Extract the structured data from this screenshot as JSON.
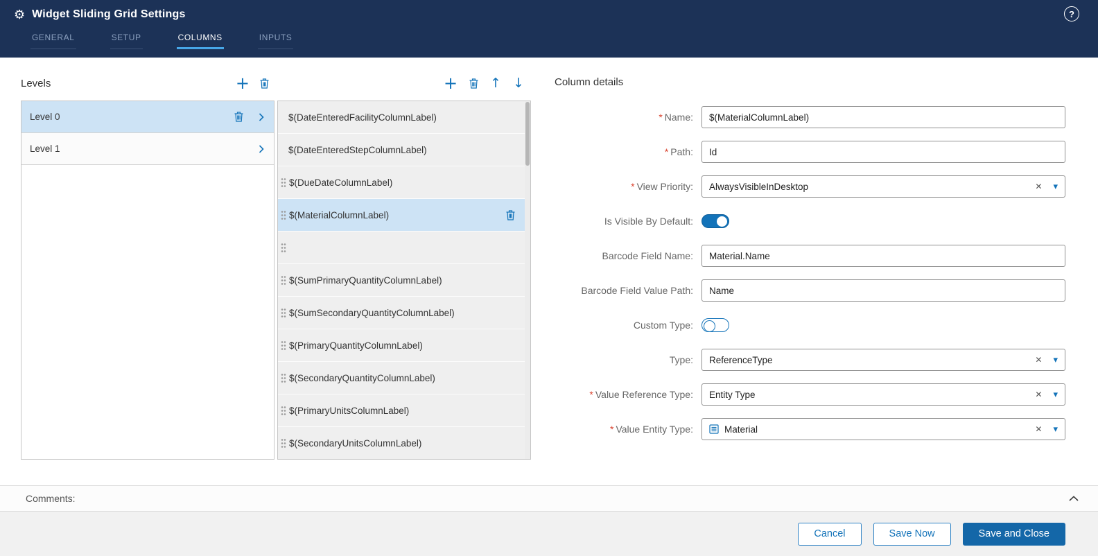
{
  "window": {
    "title": "Widget Sliding Grid Settings"
  },
  "header": {
    "tabs": [
      {
        "label": "GENERAL",
        "active": false
      },
      {
        "label": "SETUP",
        "active": false
      },
      {
        "label": "COLUMNS",
        "active": true
      },
      {
        "label": "INPUTS",
        "active": false
      }
    ]
  },
  "icons": {
    "gear": "⚙",
    "help": "?",
    "plus": "+",
    "up": "↑",
    "down": "↓",
    "clear": "✕",
    "dropdown": "▾"
  },
  "levels": {
    "title": "Levels",
    "items": [
      {
        "label": "Level 0",
        "selected": true
      },
      {
        "label": "Level 1",
        "selected": false
      }
    ]
  },
  "columns": {
    "items": [
      {
        "label": "$(DateEnteredFacilityColumnLabel)",
        "selected": false,
        "drag": false
      },
      {
        "label": "$(DateEnteredStepColumnLabel)",
        "selected": false,
        "drag": false
      },
      {
        "label": "$(DueDateColumnLabel)",
        "selected": false,
        "drag": true
      },
      {
        "label": "$(MaterialColumnLabel)",
        "selected": true,
        "drag": true
      },
      {
        "label": "",
        "selected": false,
        "drag": true
      },
      {
        "label": "$(SumPrimaryQuantityColumnLabel)",
        "selected": false,
        "drag": true
      },
      {
        "label": "$(SumSecondaryQuantityColumnLabel)",
        "selected": false,
        "drag": true
      },
      {
        "label": "$(PrimaryQuantityColumnLabel)",
        "selected": false,
        "drag": true
      },
      {
        "label": "$(SecondaryQuantityColumnLabel)",
        "selected": false,
        "drag": true
      },
      {
        "label": "$(PrimaryUnitsColumnLabel)",
        "selected": false,
        "drag": true
      },
      {
        "label": "$(SecondaryUnitsColumnLabel)",
        "selected": false,
        "drag": true
      }
    ]
  },
  "details": {
    "title": "Column details",
    "required_marker": "*",
    "fields": [
      {
        "label": "Name:",
        "required": true,
        "type": "text",
        "value": "$(MaterialColumnLabel)"
      },
      {
        "label": "Path:",
        "required": true,
        "type": "text",
        "value": "Id"
      },
      {
        "label": "View Priority:",
        "required": true,
        "type": "select",
        "value": "AlwaysVisibleInDesktop"
      },
      {
        "label": "Is Visible By Default:",
        "required": false,
        "type": "toggle",
        "value": true
      },
      {
        "label": "Barcode Field Name:",
        "required": false,
        "type": "text",
        "value": "Material.Name"
      },
      {
        "label": "Barcode Field Value Path:",
        "required": false,
        "type": "text",
        "value": "Name"
      },
      {
        "label": "Custom Type:",
        "required": false,
        "type": "toggle",
        "value": false
      },
      {
        "label": "Type:",
        "required": false,
        "type": "select",
        "value": "ReferenceType"
      },
      {
        "label": "Value Reference Type:",
        "required": true,
        "type": "select",
        "value": "Entity Type"
      },
      {
        "label": "Value Entity Type:",
        "required": true,
        "type": "select",
        "value": "Material",
        "icon": "entity-icon"
      }
    ]
  },
  "comments": {
    "label": "Comments:"
  },
  "footer": {
    "cancel_label": "Cancel",
    "save_now_label": "Save Now",
    "save_and_close_label": "Save and Close"
  },
  "colors": {
    "header_bg": "#1c3257",
    "accent": "#1373b9",
    "tab_active_underline": "#47a7e8",
    "selected_row_bg": "#cde3f5",
    "primary_button_bg": "#1467a8",
    "required_marker": "#d9432f"
  }
}
